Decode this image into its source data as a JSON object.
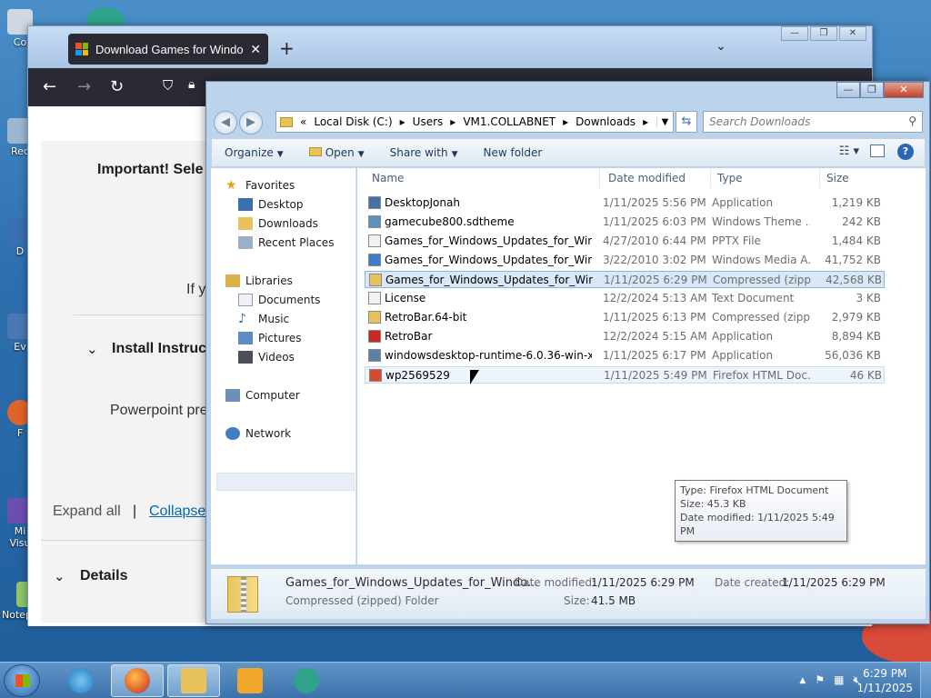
{
  "desktop": {
    "icons": [
      "Co",
      "Rec",
      "D",
      "Ev",
      "F",
      "Mi",
      "Visu",
      "Notepad++"
    ]
  },
  "browser": {
    "tab_title": "Download Games for Windows",
    "new_tab_label": "+",
    "window_buttons": [
      "—",
      "❐",
      "✕"
    ],
    "content": {
      "important": "Important! Sele",
      "if_text": "If y",
      "install_heading": "Install Instruct",
      "powerpoint_text": "Powerpoint pre",
      "expand_all": "Expand all",
      "separator": "|",
      "collapse": "Collapse",
      "details_heading": "Details"
    }
  },
  "explorer": {
    "breadcrumb": [
      "«",
      "Local Disk (C:)",
      "Users",
      "VM1.COLLABNET",
      "Downloads"
    ],
    "search_placeholder": "Search Downloads",
    "toolbar": {
      "organize": "Organize",
      "open": "Open",
      "share_with": "Share with",
      "new_folder": "New folder"
    },
    "nav": {
      "favorites": "Favorites",
      "desktop": "Desktop",
      "downloads": "Downloads",
      "recent_places": "Recent Places",
      "libraries": "Libraries",
      "documents": "Documents",
      "music": "Music",
      "pictures": "Pictures",
      "videos": "Videos",
      "computer": "Computer",
      "network": "Network"
    },
    "columns": {
      "name": "Name",
      "date": "Date modified",
      "type": "Type",
      "size": "Size"
    },
    "files": [
      {
        "name": "DesktopJonah",
        "date": "1/11/2025 5:56 PM",
        "type": "Application",
        "size": "1,219 KB",
        "icon": "app-icon",
        "color": "#4a6fa5"
      },
      {
        "name": "gamecube800.sdtheme",
        "date": "1/11/2025 6:03 PM",
        "type": "Windows Theme ...",
        "size": "242 KB",
        "icon": "theme-icon",
        "color": "#5f8fbf"
      },
      {
        "name": "Games_for_Windows_Updates_for_Wind...",
        "date": "4/27/2010 6:44 PM",
        "type": "PPTX File",
        "size": "1,484 KB",
        "icon": "document-icon",
        "color": "#f2f2f2"
      },
      {
        "name": "Games_for_Windows_Updates_for_Wind...",
        "date": "3/22/2010 3:02 PM",
        "type": "Windows Media A...",
        "size": "41,752 KB",
        "icon": "media-icon",
        "color": "#3d7cc9"
      },
      {
        "name": "Games_for_Windows_Updates_for_Wind...",
        "date": "1/11/2025 6:29 PM",
        "type": "Compressed (zipp...",
        "size": "42,568 KB",
        "icon": "zip-folder-icon",
        "color": "#e8c35b"
      },
      {
        "name": "License",
        "date": "12/2/2024 5:13 AM",
        "type": "Text Document",
        "size": "3 KB",
        "icon": "text-document-icon",
        "color": "#f2f2f2"
      },
      {
        "name": "RetroBar.64-bit",
        "date": "1/11/2025 6:13 PM",
        "type": "Compressed (zipp...",
        "size": "2,979 KB",
        "icon": "zip-folder-icon",
        "color": "#e8c35b"
      },
      {
        "name": "RetroBar",
        "date": "12/2/2024 5:15 AM",
        "type": "Application",
        "size": "8,894 KB",
        "icon": "retrobar-icon",
        "color": "#c62828"
      },
      {
        "name": "windowsdesktop-runtime-6.0.36-win-x64",
        "date": "1/11/2025 6:17 PM",
        "type": "Application",
        "size": "56,036 KB",
        "icon": "installer-icon",
        "color": "#5a7fa8"
      },
      {
        "name": "wp2569529",
        "date": "1/11/2025 5:49 PM",
        "type": "Firefox HTML Doc...",
        "size": "46 KB",
        "icon": "firefox-doc-icon",
        "color": "#d84a2b"
      }
    ],
    "tooltip": {
      "type": "Type: Firefox HTML Document",
      "size": "Size: 45.3 KB",
      "date": "Date modified: 1/11/2025 5:49 PM"
    },
    "details": {
      "name": "Games_for_Windows_Updates_for_Windo...",
      "kind": "Compressed (zipped) Folder",
      "date_modified_label": "Date modified:",
      "date_modified": "1/11/2025 6:29 PM",
      "date_created_label": "Date created:",
      "date_created": "1/11/2025 6:29 PM",
      "size_label": "Size:",
      "size": "41.5 MB"
    }
  },
  "taskbar": {
    "time": "6:29 PM",
    "date": "1/11/2025",
    "tray_show_hidden": "▲"
  }
}
